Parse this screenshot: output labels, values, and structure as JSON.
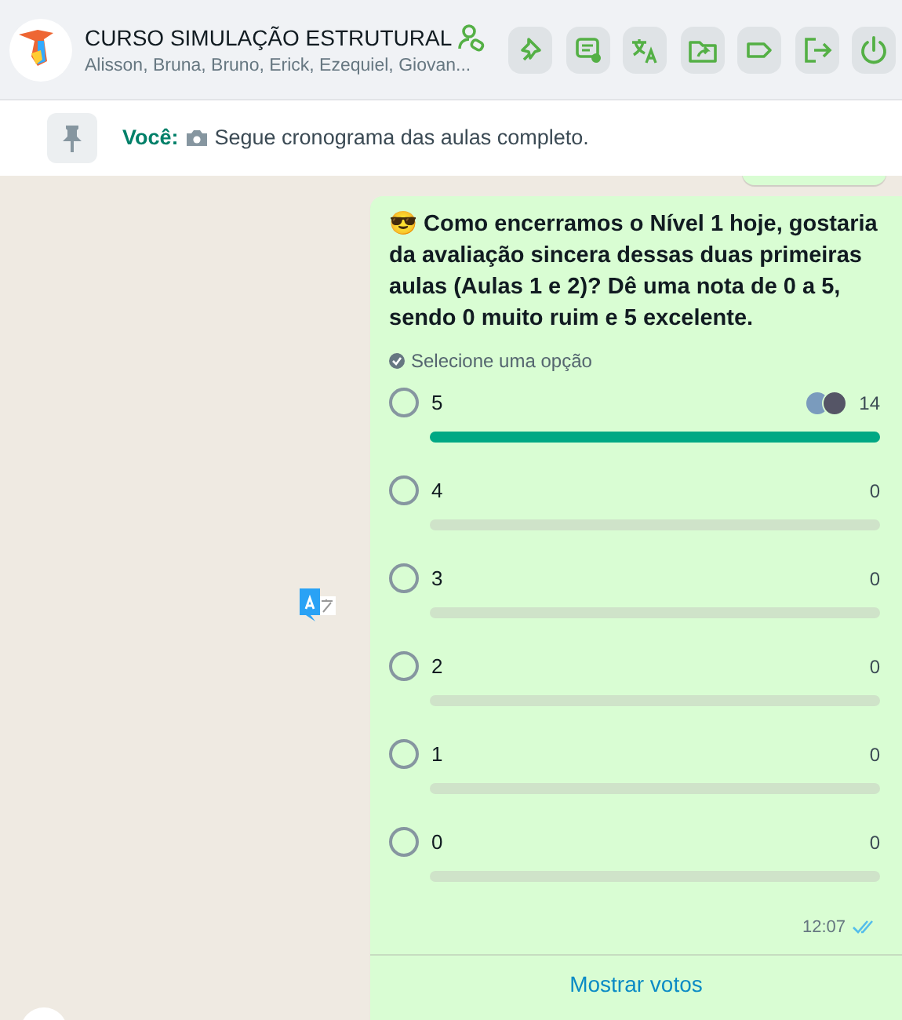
{
  "header": {
    "title": "CURSO SIMULAÇÃO ESTRUTURAL",
    "members": "Alisson, Bruna, Bruno, Erick, Ezequiel, Giovan..."
  },
  "pinned": {
    "sender": "Você:",
    "text": "Segue cronograma das aulas completo."
  },
  "poll": {
    "question": "😎 Como encerramos o Nível 1 hoje, gostaria da avaliação sincera dessas duas primeiras aulas (Aulas 1 e 2)? Dê uma nota de 0 a 5, sendo 0 muito ruim e 5 excelente.",
    "hint": "Selecione uma opção",
    "options": [
      {
        "label": "5",
        "count": "14",
        "level": 1,
        "selected": false,
        "voter_avatars": true
      },
      {
        "label": "4",
        "count": "0",
        "level": 0,
        "selected": false,
        "voter_avatars": false
      },
      {
        "label": "3",
        "count": "0",
        "level": 0,
        "selected": false,
        "voter_avatars": false
      },
      {
        "label": "2",
        "count": "0",
        "level": 0,
        "selected": false,
        "voter_avatars": false
      },
      {
        "label": "1",
        "count": "0",
        "level": 0,
        "selected": false,
        "voter_avatars": false
      },
      {
        "label": "0",
        "count": "0",
        "level": 0,
        "selected": false,
        "voter_avatars": false
      }
    ],
    "time": "12:07",
    "read": true,
    "show_votes": "Mostrar votos"
  }
}
